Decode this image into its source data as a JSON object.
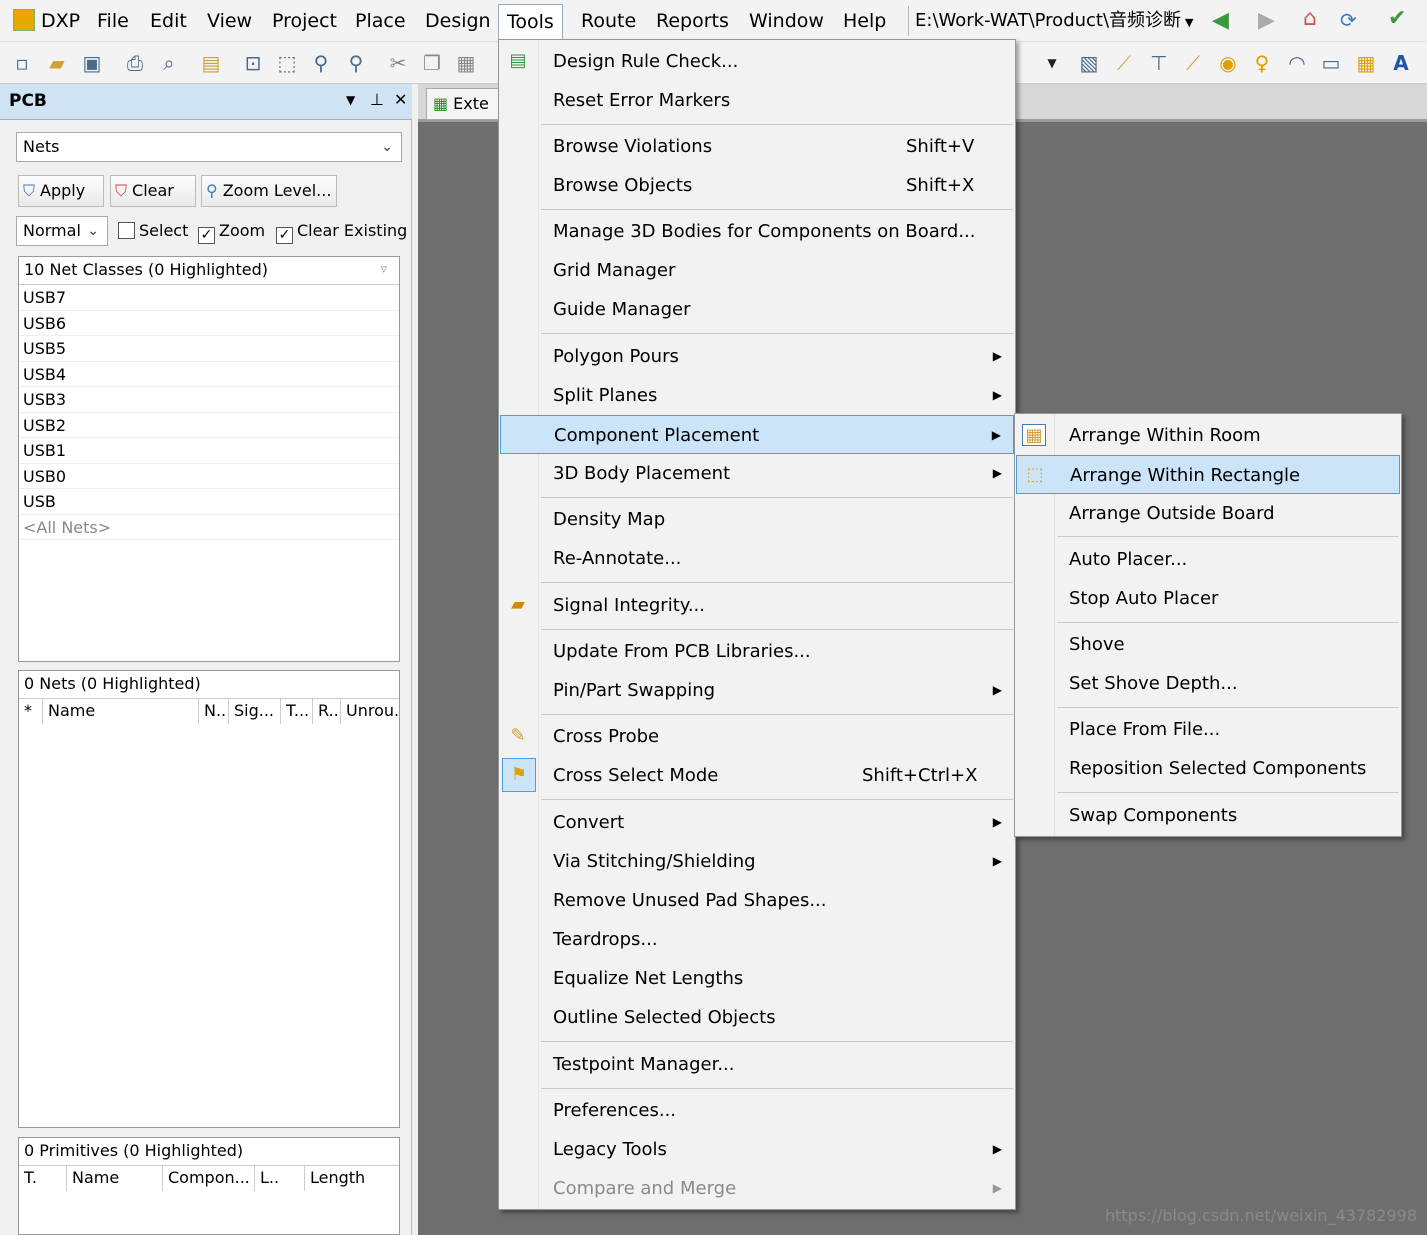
{
  "menubar": {
    "items": [
      "DXP",
      "File",
      "Edit",
      "View",
      "Project",
      "Place",
      "Design",
      "Tools",
      "Route",
      "Reports",
      "Window",
      "Help"
    ],
    "path": "E:\\Work-WAT\\Product\\音频诊断"
  },
  "panel": {
    "title": "PCB",
    "mode_select": "Nets",
    "buttons": {
      "apply": "Apply",
      "clear": "Clear",
      "zoom_level": "Zoom Level..."
    },
    "mask_mode": "Normal",
    "checks": {
      "select": "Select",
      "zoom": "Zoom",
      "clear_existing": "Clear Existing"
    },
    "net_classes": {
      "header": "10 Net Classes (0 Highlighted)",
      "items": [
        "USB7",
        "USB6",
        "USB5",
        "USB4",
        "USB3",
        "USB2",
        "USB1",
        "USB0",
        "USB",
        "<All Nets>"
      ]
    },
    "nets": {
      "header": "0 Nets (0 Highlighted)",
      "columns": [
        "*",
        "Name",
        "N..",
        "Sig...",
        "T...",
        "R..",
        "Unrou..."
      ]
    },
    "primitives": {
      "header": "0 Primitives (0 Highlighted)",
      "columns": [
        "T.",
        "Name",
        "Compon...",
        "L..",
        "Length"
      ]
    }
  },
  "document_tab": "Exte",
  "tools_menu": {
    "items": [
      {
        "label": "Design Rule Check...",
        "shortcut": "",
        "icon": "drc-icon"
      },
      {
        "label": "Reset Error Markers",
        "shortcut": ""
      },
      {
        "label": "Browse Violations",
        "shortcut": "Shift+V"
      },
      {
        "label": "Browse Objects",
        "shortcut": "Shift+X"
      },
      {
        "label": "Manage 3D Bodies for Components on Board...",
        "shortcut": ""
      },
      {
        "label": "Grid Manager",
        "shortcut": ""
      },
      {
        "label": "Guide Manager",
        "shortcut": ""
      },
      {
        "label": "Polygon Pours",
        "shortcut": ""
      },
      {
        "label": "Split Planes",
        "shortcut": ""
      },
      {
        "label": "Component Placement",
        "shortcut": ""
      },
      {
        "label": "3D Body Placement",
        "shortcut": ""
      },
      {
        "label": "Density Map",
        "shortcut": ""
      },
      {
        "label": "Re-Annotate...",
        "shortcut": ""
      },
      {
        "label": "Signal Integrity...",
        "shortcut": ""
      },
      {
        "label": "Update From PCB Libraries...",
        "shortcut": ""
      },
      {
        "label": "Pin/Part Swapping",
        "shortcut": ""
      },
      {
        "label": "Cross Probe",
        "shortcut": ""
      },
      {
        "label": "Cross Select Mode",
        "shortcut": "Shift+Ctrl+X"
      },
      {
        "label": "Convert",
        "shortcut": ""
      },
      {
        "label": "Via Stitching/Shielding",
        "shortcut": ""
      },
      {
        "label": "Remove Unused Pad Shapes...",
        "shortcut": ""
      },
      {
        "label": "Teardrops...",
        "shortcut": ""
      },
      {
        "label": "Equalize Net Lengths",
        "shortcut": ""
      },
      {
        "label": "Outline Selected Objects",
        "shortcut": ""
      },
      {
        "label": "Testpoint Manager...",
        "shortcut": ""
      },
      {
        "label": "Preferences...",
        "shortcut": ""
      },
      {
        "label": "Legacy Tools",
        "shortcut": ""
      },
      {
        "label": "Compare and Merge",
        "shortcut": ""
      }
    ]
  },
  "placement_submenu": {
    "items": [
      {
        "label": "Arrange Within Room"
      },
      {
        "label": "Arrange Within Rectangle"
      },
      {
        "label": "Arrange Outside Board"
      },
      {
        "label": "Auto Placer..."
      },
      {
        "label": "Stop Auto Placer"
      },
      {
        "label": "Shove"
      },
      {
        "label": "Set Shove Depth..."
      },
      {
        "label": "Place From File..."
      },
      {
        "label": "Reposition Selected Components"
      },
      {
        "label": "Swap Components"
      }
    ]
  },
  "watermark": "https://blog.csdn.net/weixin_43782998",
  "colors": {
    "highlight": "#cce4f7",
    "highlight_border": "#4d9de0",
    "panel_header": "#cfe3f5",
    "workspace": "#6e6e6e"
  }
}
